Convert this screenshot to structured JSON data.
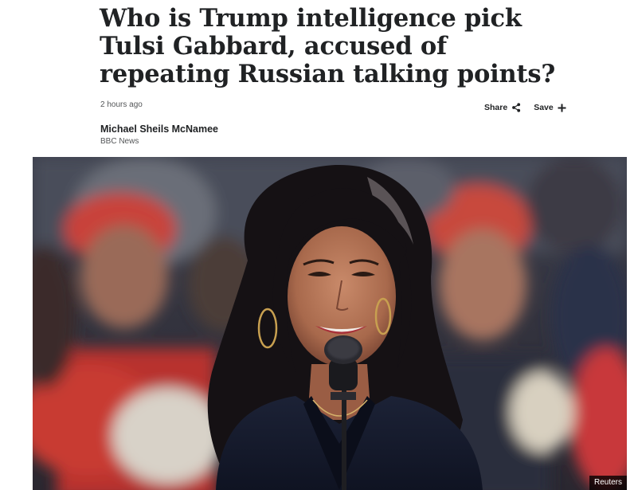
{
  "article": {
    "headline": "Who is Trump intelligence pick Tulsi Gabbard, accused of repeating Russian talking points?",
    "timestamp": "2 hours ago",
    "author": "Michael Sheils McNamee",
    "outlet": "BBC News"
  },
  "actions": {
    "share_label": "Share",
    "save_label": "Save"
  },
  "image": {
    "credit": "Reuters"
  },
  "icons": {
    "share": "share-icon",
    "save": "plus-icon"
  }
}
